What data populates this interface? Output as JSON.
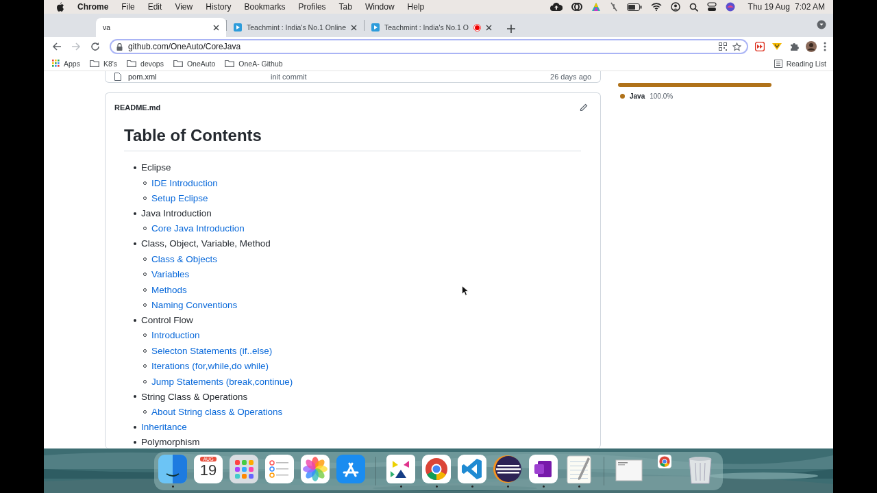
{
  "menu_bar": {
    "app_name": "Chrome",
    "menus": [
      "File",
      "Edit",
      "View",
      "History",
      "Bookmarks",
      "Profiles",
      "Tab",
      "Window",
      "Help"
    ],
    "date": "Thu 19 Aug",
    "time": "7:02 AM"
  },
  "tabs": [
    {
      "title": "va",
      "selected": true,
      "recording": false
    },
    {
      "title": "Teachmint : India's No.1 Online",
      "selected": false,
      "recording": false
    },
    {
      "title": "Teachmint : India's No.1 O",
      "selected": false,
      "recording": true
    }
  ],
  "toolbar": {
    "url": "github.com/OneAuto/CoreJava"
  },
  "bookmarks": [
    {
      "kind": "apps",
      "label": "Apps"
    },
    {
      "kind": "folder",
      "label": "K8's"
    },
    {
      "kind": "folder",
      "label": "devops"
    },
    {
      "kind": "folder",
      "label": "OneAuto"
    },
    {
      "kind": "folder",
      "label": "OneA- Github"
    }
  ],
  "reading_list": "Reading List",
  "file_row": {
    "name": "pom.xml",
    "message": "init commit",
    "age": "26 days ago"
  },
  "readme": {
    "filename": "README.md",
    "heading": "Table of Contents",
    "items": [
      {
        "text": "Eclipse",
        "kind": "text",
        "children": [
          {
            "text": "IDE Introduction",
            "kind": "link"
          },
          {
            "text": "Setup Eclipse",
            "kind": "link"
          }
        ]
      },
      {
        "text": "Java Introduction",
        "kind": "text",
        "children": [
          {
            "text": "Core Java Introduction",
            "kind": "link"
          }
        ]
      },
      {
        "text": "Class, Object, Variable, Method",
        "kind": "text",
        "children": [
          {
            "text": "Class & Objects",
            "kind": "link"
          },
          {
            "text": "Variables",
            "kind": "link"
          },
          {
            "text": "Methods",
            "kind": "link"
          },
          {
            "text": "Naming Conventions",
            "kind": "link"
          }
        ]
      },
      {
        "text": "Control Flow",
        "kind": "text",
        "children": [
          {
            "text": "Introduction",
            "kind": "link"
          },
          {
            "text": "Selecton Statements (if..else)",
            "kind": "link"
          },
          {
            "text": "Iterations (for,while,do while)",
            "kind": "link"
          },
          {
            "text": "Jump Statements (break,continue)",
            "kind": "link"
          }
        ]
      },
      {
        "text": "String Class & Operations",
        "kind": "text",
        "children": [
          {
            "text": "About String class & Operations",
            "kind": "link"
          }
        ]
      },
      {
        "text": "Inheritance",
        "kind": "link"
      },
      {
        "text": "Polymorphism",
        "kind": "text"
      }
    ]
  },
  "languages": [
    {
      "name": "Java",
      "percent": "100.0%",
      "color": "#b07219",
      "level": 1
    }
  ],
  "dock": {
    "sections": [
      [
        {
          "kind": "finder",
          "running": true
        },
        {
          "kind": "calendar",
          "month": "AUG",
          "day": "19",
          "running": false
        },
        {
          "kind": "launchpad",
          "running": false
        },
        {
          "kind": "reminders",
          "running": false
        },
        {
          "kind": "photos",
          "running": false
        },
        {
          "kind": "appstore",
          "running": false
        }
      ],
      [
        {
          "kind": "triangles",
          "running": true
        },
        {
          "kind": "chrome",
          "running": true
        },
        {
          "kind": "vscode",
          "running": true
        },
        {
          "kind": "eclipse",
          "running": true
        },
        {
          "kind": "onenote",
          "running": true
        },
        {
          "kind": "textedit",
          "running": true
        }
      ],
      [
        {
          "kind": "window",
          "running": false
        },
        {
          "kind": "minimized",
          "running": false
        },
        {
          "kind": "trash",
          "running": false
        }
      ]
    ]
  }
}
